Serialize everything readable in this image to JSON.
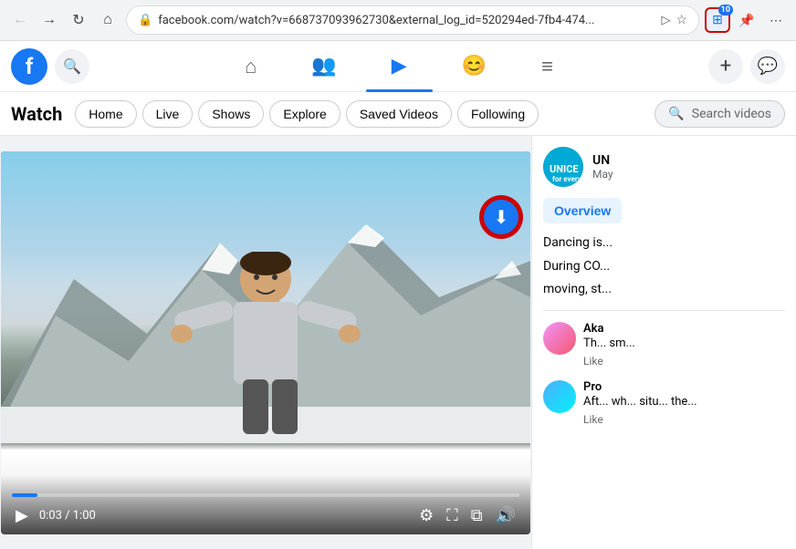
{
  "browser": {
    "back_btn": "←",
    "forward_btn": "→",
    "reload_btn": "↻",
    "home_btn": "⌂",
    "address": "facebook.com/watch?v=668737093962730&external_log_id=520294ed-7fb4-474...",
    "shield_icon": "🔒",
    "forward_icon": "▷",
    "star_icon": "☆",
    "extension_count": "10",
    "extensions_btn": "⊞",
    "more_btn": "⋯"
  },
  "facebook_nav": {
    "logo": "f",
    "search_icon": "🔍",
    "home_icon": "⌂",
    "friends_icon": "👥",
    "video_icon": "▶",
    "gaming_icon": "😊",
    "menu_icon": "≡",
    "plus_icon": "+",
    "messenger_icon": "💬"
  },
  "watch_bar": {
    "title": "Watch",
    "nav_items": [
      {
        "label": "Home"
      },
      {
        "label": "Live"
      },
      {
        "label": "Shows"
      },
      {
        "label": "Explore"
      },
      {
        "label": "Saved Videos"
      },
      {
        "label": "Following"
      }
    ],
    "search_placeholder": "Search videos"
  },
  "video": {
    "time_current": "0:03",
    "time_total": "1:00",
    "progress_percent": 5,
    "play_icon": "▶",
    "settings_icon": "⚙",
    "fullscreen_icon": "⛶",
    "pip_icon": "⧉",
    "volume_icon": "🔊",
    "download_icon": "⬇"
  },
  "sidebar": {
    "channel_name": "UN",
    "channel_date": "May",
    "overview_btn": "Overview",
    "desc_line1": "Dancing is...",
    "desc_line2": "During CO...",
    "desc_line3": "moving, st...",
    "comments": [
      {
        "name": "Aka",
        "text": "Th... sm...",
        "action": "Like"
      },
      {
        "name": "Pro",
        "text": "Aft... wh... situ... the...",
        "action": "Like"
      }
    ]
  }
}
